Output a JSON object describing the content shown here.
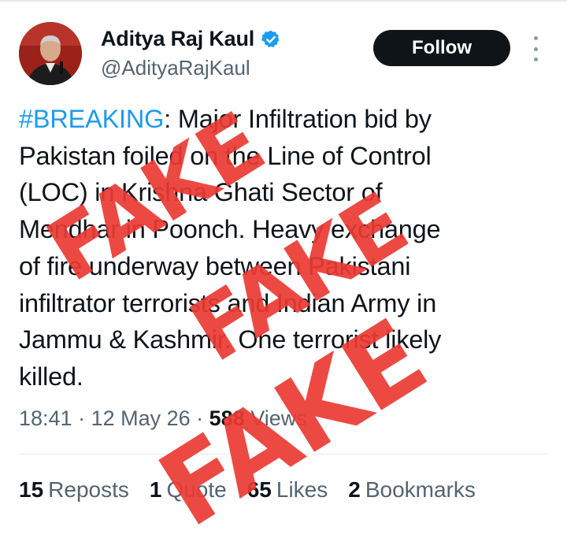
{
  "tweet": {
    "author": {
      "name": "Aditya Raj Kaul",
      "handle": "@AdityaRajKaul",
      "verified": true,
      "verified_color": "#1d9bf0"
    },
    "follow_label": "Follow",
    "more_icon": "more-vertical-icon",
    "text": {
      "hashtag": "#BREAKING",
      "line1_rest": ": Major Infiltration bid by",
      "line2": "Pakistan foiled on the Line of Control",
      "line3": "(LOC) in Krishna Ghati Sector of",
      "line4": "Mendhar in Poonch. Heavy exchange",
      "line5": "of fire underway between Pakistani",
      "line6": "infiltrator terrorists and Indian Army in",
      "line7": "Jammu & Kashmir. One terrorist likely",
      "line8": "killed."
    },
    "meta": {
      "time": "18:41",
      "separator": " · ",
      "date": "12 May 26",
      "views_count": "588",
      "views_label": "Views"
    },
    "stats": [
      {
        "count": "15",
        "label": "Reposts"
      },
      {
        "count": "1",
        "label": "Quote"
      },
      {
        "count": "65",
        "label": "Likes"
      },
      {
        "count": "2",
        "label": "Bookmarks"
      }
    ]
  },
  "overlay": {
    "stamp_text": "FAKE",
    "stamp_color": "#ea3a33"
  }
}
